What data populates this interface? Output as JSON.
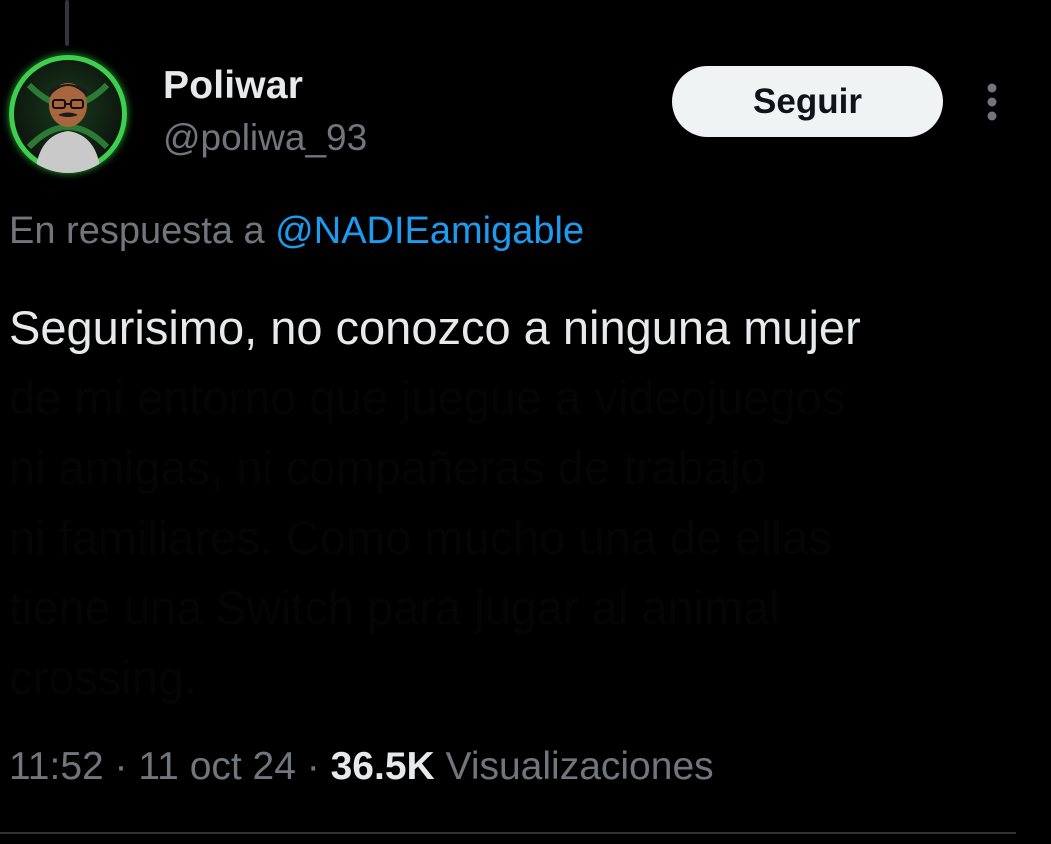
{
  "author": {
    "display_name": "Poliwar",
    "handle": "@poliwa_93",
    "avatar_ring_color": "#3fcf4f"
  },
  "actions": {
    "follow_label": "Seguir",
    "more_icon": "more-vertical-icon"
  },
  "reply": {
    "prefix": "En respuesta a ",
    "mention": "@NADIEamigable",
    "mention_color": "#1d9bf0"
  },
  "tweet": {
    "lines": [
      "Segurisimo, no conozco a ninguna mujer",
      "de mi entorno que juegue a videojuegos",
      "ni amigas, ni compañeras de trabajo",
      "ni familiares. Como mucho una de ellas",
      "tiene una Switch para jugar al animal",
      "crossing."
    ]
  },
  "meta": {
    "time": "11:52",
    "separator": " · ",
    "date": "11 oct 24",
    "views_count": "36.5K",
    "views_label": " Visualizaciones"
  }
}
